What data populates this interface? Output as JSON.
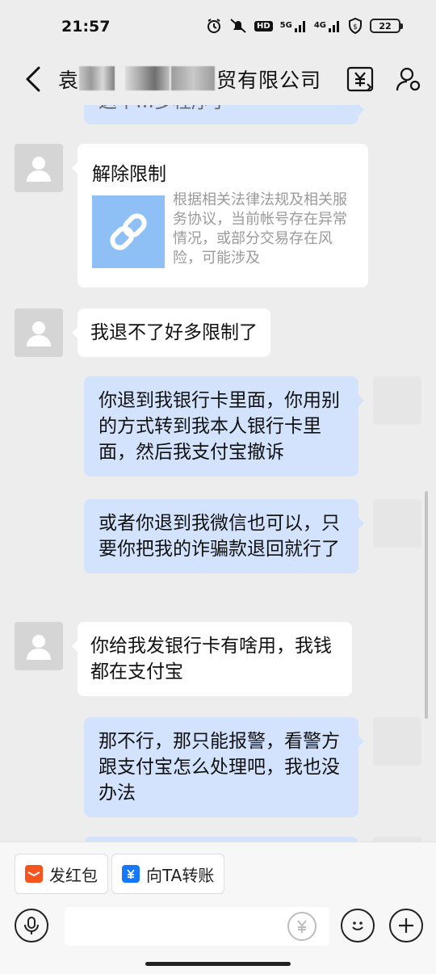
{
  "status_bar": {
    "time": "21:57",
    "network_1": "5G",
    "network_2": "4G",
    "battery": "22",
    "hd_label": "HD"
  },
  "header": {
    "title_prefix": "袁",
    "title_suffix": "贸有限公司",
    "icons": [
      "back-arrow-icon",
      "yen-transfer-icon",
      "user-settings-icon"
    ]
  },
  "messages": [
    {
      "side": "right",
      "text": "这个…多程序了",
      "partial": true
    },
    {
      "side": "left",
      "type": "card",
      "title": "解除限制",
      "description": "根据相关法律法规及相关服务协议，当前帐号存在异常情况，或部分交易存在风险，可能涉及",
      "thumb_icon": "link-icon"
    },
    {
      "side": "left",
      "text": "我退不了好多限制了"
    },
    {
      "side": "right",
      "text": "你退到我银行卡里面，你用别的方式转到我本人银行卡里面，然后我支付宝撤诉"
    },
    {
      "side": "right",
      "text": "或者你退到我微信也可以，只要你把我的诈骗款退回就行了"
    },
    {
      "side": "left",
      "text": "你给我发银行卡有啥用，我钱都在支付宝"
    },
    {
      "side": "right",
      "text": "那不行，那只能报警，看警方跟支付宝怎么处理吧，我也没办法"
    }
  ],
  "quick_actions": {
    "red_packet": "发红包",
    "transfer": "向TA转账"
  },
  "input_bar": {
    "placeholder": "",
    "icons": [
      "microphone-icon",
      "yen-icon",
      "emoji-icon",
      "plus-icon"
    ]
  },
  "colors": {
    "background": "#ededed",
    "bubble_self": "#d3e3fd",
    "bubble_other": "#ffffff",
    "red_packet": "#f5541d",
    "transfer": "#1677ff"
  }
}
